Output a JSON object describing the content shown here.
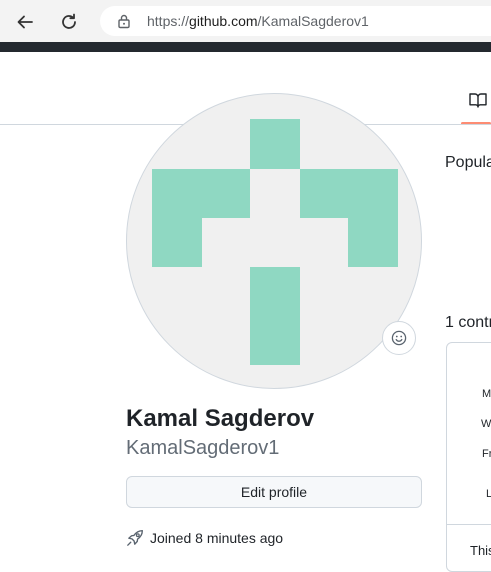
{
  "browser": {
    "url_prefix": "https://",
    "url_host": "github.com",
    "url_path": "/KamalSagderov1"
  },
  "profile": {
    "full_name": "Kamal Sagderov",
    "username": "KamalSagderov1",
    "edit_button": "Edit profile",
    "joined": "Joined 8 minutes ago",
    "avatar_color": "#8fd8c2"
  },
  "sidebar_right": {
    "popular_heading": "Popula",
    "contributions_heading": "1 contr",
    "day_labels": [
      "M",
      "W",
      "Fr"
    ],
    "legend_label": "L",
    "footer_text": "This"
  },
  "colors": {
    "tab_accent": "#fd8c73",
    "border": "#d0d7de",
    "muted_text": "#636c76"
  }
}
